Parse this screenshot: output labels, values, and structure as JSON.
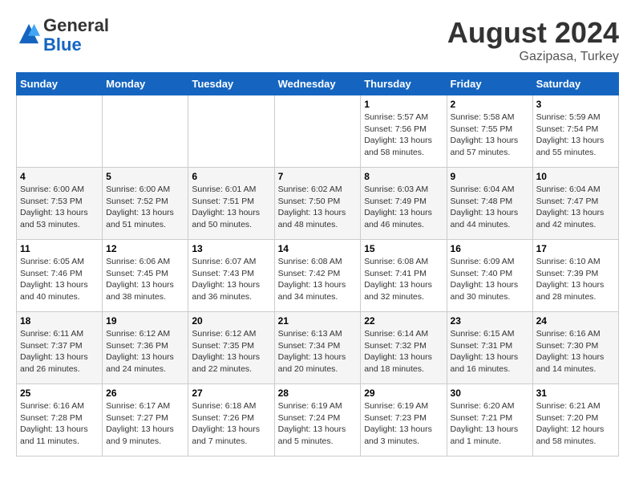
{
  "logo": {
    "general": "General",
    "blue": "Blue"
  },
  "header": {
    "month": "August 2024",
    "location": "Gazipasa, Turkey"
  },
  "weekdays": [
    "Sunday",
    "Monday",
    "Tuesday",
    "Wednesday",
    "Thursday",
    "Friday",
    "Saturday"
  ],
  "weeks": [
    [
      {
        "day": "",
        "info": ""
      },
      {
        "day": "",
        "info": ""
      },
      {
        "day": "",
        "info": ""
      },
      {
        "day": "",
        "info": ""
      },
      {
        "day": "1",
        "info": "Sunrise: 5:57 AM\nSunset: 7:56 PM\nDaylight: 13 hours\nand 58 minutes."
      },
      {
        "day": "2",
        "info": "Sunrise: 5:58 AM\nSunset: 7:55 PM\nDaylight: 13 hours\nand 57 minutes."
      },
      {
        "day": "3",
        "info": "Sunrise: 5:59 AM\nSunset: 7:54 PM\nDaylight: 13 hours\nand 55 minutes."
      }
    ],
    [
      {
        "day": "4",
        "info": "Sunrise: 6:00 AM\nSunset: 7:53 PM\nDaylight: 13 hours\nand 53 minutes."
      },
      {
        "day": "5",
        "info": "Sunrise: 6:00 AM\nSunset: 7:52 PM\nDaylight: 13 hours\nand 51 minutes."
      },
      {
        "day": "6",
        "info": "Sunrise: 6:01 AM\nSunset: 7:51 PM\nDaylight: 13 hours\nand 50 minutes."
      },
      {
        "day": "7",
        "info": "Sunrise: 6:02 AM\nSunset: 7:50 PM\nDaylight: 13 hours\nand 48 minutes."
      },
      {
        "day": "8",
        "info": "Sunrise: 6:03 AM\nSunset: 7:49 PM\nDaylight: 13 hours\nand 46 minutes."
      },
      {
        "day": "9",
        "info": "Sunrise: 6:04 AM\nSunset: 7:48 PM\nDaylight: 13 hours\nand 44 minutes."
      },
      {
        "day": "10",
        "info": "Sunrise: 6:04 AM\nSunset: 7:47 PM\nDaylight: 13 hours\nand 42 minutes."
      }
    ],
    [
      {
        "day": "11",
        "info": "Sunrise: 6:05 AM\nSunset: 7:46 PM\nDaylight: 13 hours\nand 40 minutes."
      },
      {
        "day": "12",
        "info": "Sunrise: 6:06 AM\nSunset: 7:45 PM\nDaylight: 13 hours\nand 38 minutes."
      },
      {
        "day": "13",
        "info": "Sunrise: 6:07 AM\nSunset: 7:43 PM\nDaylight: 13 hours\nand 36 minutes."
      },
      {
        "day": "14",
        "info": "Sunrise: 6:08 AM\nSunset: 7:42 PM\nDaylight: 13 hours\nand 34 minutes."
      },
      {
        "day": "15",
        "info": "Sunrise: 6:08 AM\nSunset: 7:41 PM\nDaylight: 13 hours\nand 32 minutes."
      },
      {
        "day": "16",
        "info": "Sunrise: 6:09 AM\nSunset: 7:40 PM\nDaylight: 13 hours\nand 30 minutes."
      },
      {
        "day": "17",
        "info": "Sunrise: 6:10 AM\nSunset: 7:39 PM\nDaylight: 13 hours\nand 28 minutes."
      }
    ],
    [
      {
        "day": "18",
        "info": "Sunrise: 6:11 AM\nSunset: 7:37 PM\nDaylight: 13 hours\nand 26 minutes."
      },
      {
        "day": "19",
        "info": "Sunrise: 6:12 AM\nSunset: 7:36 PM\nDaylight: 13 hours\nand 24 minutes."
      },
      {
        "day": "20",
        "info": "Sunrise: 6:12 AM\nSunset: 7:35 PM\nDaylight: 13 hours\nand 22 minutes."
      },
      {
        "day": "21",
        "info": "Sunrise: 6:13 AM\nSunset: 7:34 PM\nDaylight: 13 hours\nand 20 minutes."
      },
      {
        "day": "22",
        "info": "Sunrise: 6:14 AM\nSunset: 7:32 PM\nDaylight: 13 hours\nand 18 minutes."
      },
      {
        "day": "23",
        "info": "Sunrise: 6:15 AM\nSunset: 7:31 PM\nDaylight: 13 hours\nand 16 minutes."
      },
      {
        "day": "24",
        "info": "Sunrise: 6:16 AM\nSunset: 7:30 PM\nDaylight: 13 hours\nand 14 minutes."
      }
    ],
    [
      {
        "day": "25",
        "info": "Sunrise: 6:16 AM\nSunset: 7:28 PM\nDaylight: 13 hours\nand 11 minutes."
      },
      {
        "day": "26",
        "info": "Sunrise: 6:17 AM\nSunset: 7:27 PM\nDaylight: 13 hours\nand 9 minutes."
      },
      {
        "day": "27",
        "info": "Sunrise: 6:18 AM\nSunset: 7:26 PM\nDaylight: 13 hours\nand 7 minutes."
      },
      {
        "day": "28",
        "info": "Sunrise: 6:19 AM\nSunset: 7:24 PM\nDaylight: 13 hours\nand 5 minutes."
      },
      {
        "day": "29",
        "info": "Sunrise: 6:19 AM\nSunset: 7:23 PM\nDaylight: 13 hours\nand 3 minutes."
      },
      {
        "day": "30",
        "info": "Sunrise: 6:20 AM\nSunset: 7:21 PM\nDaylight: 13 hours\nand 1 minute."
      },
      {
        "day": "31",
        "info": "Sunrise: 6:21 AM\nSunset: 7:20 PM\nDaylight: 12 hours\nand 58 minutes."
      }
    ]
  ]
}
